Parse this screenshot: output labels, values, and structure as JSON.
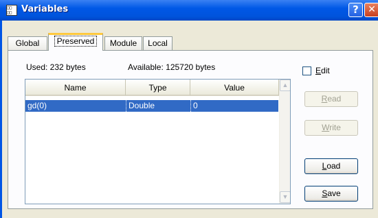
{
  "window": {
    "title": "Variables",
    "icon": "variables-app-icon",
    "help_label": "?",
    "close_label": "✕"
  },
  "tabs": [
    {
      "label": "Global",
      "active": false
    },
    {
      "label": "Preserved",
      "active": true
    },
    {
      "label": "Module",
      "active": false
    },
    {
      "label": "Local",
      "active": false
    }
  ],
  "stats": {
    "used": "Used: 232 bytes",
    "available": "Available: 125720 bytes"
  },
  "table": {
    "columns": [
      "Name",
      "Type",
      "Value"
    ],
    "rows": [
      {
        "name": "gd(0)",
        "type": "Double",
        "value": "0",
        "selected": true
      }
    ]
  },
  "scrollbar": {
    "up": "▲",
    "down": "▼"
  },
  "edit": {
    "mnemonic": "E",
    "rest": "dit",
    "checked": false
  },
  "buttons": {
    "read": {
      "mnemonic": "R",
      "rest": "ead",
      "enabled": false
    },
    "write": {
      "mnemonic": "W",
      "rest": "rite",
      "enabled": false
    },
    "load": {
      "mnemonic": "L",
      "rest": "oad",
      "enabled": true
    },
    "save": {
      "mnemonic": "S",
      "rest": "ave",
      "enabled": true
    }
  },
  "colors": {
    "titlebar": "#0058E6",
    "selection": "#316AC5",
    "tab_highlight": "#FFC83C",
    "dialog_bg": "#ECE9D8"
  }
}
